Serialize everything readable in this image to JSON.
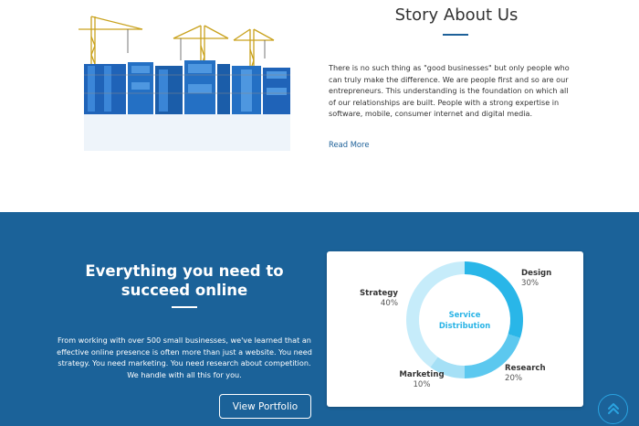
{
  "story": {
    "title": "Story About Us",
    "body": "There is no such thing as \"good businesses\" but only people who can truly make the difference. We are people first and so are our entrepreneurs. This understanding is the foundation on which all of our relationships are built. People with a strong expertise in software, mobile, consumer internet and digital media.",
    "read_more_label": "Read More",
    "image_icon": "website-construction-image"
  },
  "pitch": {
    "title_line1": "Everything you need to",
    "title_line2": "succeed online",
    "body": "From working with over 500 small businesses, we've learned that an effective online presence is often more than just a website. You need strategy. You need marketing. You need research about competition. We handle with all this for you.",
    "button_label": "View Portfolio"
  },
  "chart_data": {
    "type": "pie",
    "style": "donut",
    "center_label_line1": "Service",
    "center_label_line2": "Distribution",
    "categories": [
      "Design",
      "Research",
      "Marketing",
      "Strategy"
    ],
    "values": [
      30,
      20,
      10,
      40
    ],
    "value_labels": [
      "30%",
      "20%",
      "10%",
      "40%"
    ],
    "colors": [
      "#29b6e8",
      "#5cc8ef",
      "#a5e0f6",
      "#c6ecfa"
    ]
  },
  "colors": {
    "brand_blue": "#1b6299",
    "accent": "#29b6e8"
  },
  "scroll_top_icon": "double-chevron-up-icon"
}
